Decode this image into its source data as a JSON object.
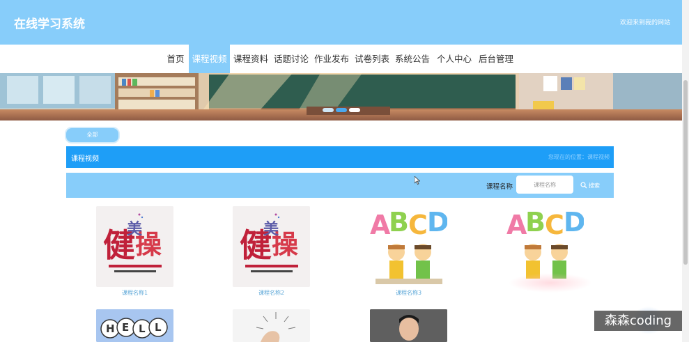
{
  "header": {
    "site_title": "在线学习系统",
    "welcome": "欢迎来到我的网站"
  },
  "nav": {
    "items": [
      {
        "label": "首页",
        "active": false
      },
      {
        "label": "课程视频",
        "active": true
      },
      {
        "label": "课程资料",
        "active": false
      },
      {
        "label": "话题讨论",
        "active": false
      },
      {
        "label": "作业发布",
        "active": false
      },
      {
        "label": "试卷列表",
        "active": false
      },
      {
        "label": "系统公告",
        "active": false
      },
      {
        "label": "个人中心",
        "active": false
      },
      {
        "label": "后台管理",
        "active": false
      }
    ]
  },
  "banner": {
    "active_dot": 1
  },
  "filter": {
    "all_label": "全部"
  },
  "section": {
    "title": "课程视频",
    "breadcrumb": "您现在的位置：课程视频"
  },
  "search": {
    "label": "课程名称",
    "placeholder": "课程名称",
    "button_label": "搜索",
    "icon": "search-icon"
  },
  "courses": [
    {
      "name": "课程名称1",
      "image": "jianmeicao-poster"
    },
    {
      "name": "课程名称2",
      "image": "jianmeicao-poster"
    },
    {
      "name": "课程名称3",
      "image": "abcd-kids"
    },
    {
      "name": "",
      "image": "abcd-kids"
    },
    {
      "name": "",
      "image": "hello-letters"
    },
    {
      "name": "",
      "image": "lightbulb-hand"
    },
    {
      "name": "",
      "image": "man-portrait"
    }
  ],
  "watermark": {
    "text": "森森coding"
  },
  "colors": {
    "header_bg": "#87cdfa",
    "nav_active_bg": "#87cdfa",
    "section_bar": "#1e9ef7",
    "search_bar": "#87cdfa",
    "course_label": "#5ea8d8"
  }
}
